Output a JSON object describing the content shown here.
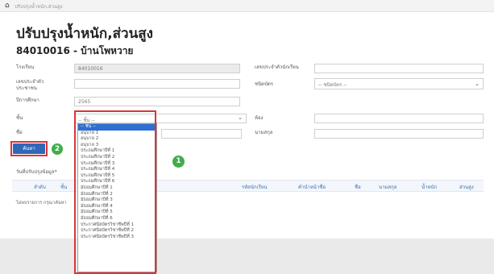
{
  "breadcrumb": {
    "text": "ปรับปรุงน้ำหนัก,ส่วนสูง"
  },
  "page": {
    "title": "ปรับปรุงน้ำหนัก,ส่วนสูง",
    "subtitle": "84010016 - บ้านโพหวาย"
  },
  "form": {
    "school_label": "โรงเรียน",
    "school_value": "84010016",
    "student_no_label": "เลขประจำตัวนักเรียน",
    "student_no_value": "",
    "citizen_id_label": "เลขประจำตัวประชาชน",
    "citizen_id_value": "",
    "prefix_label": "ชนิดบัตร",
    "prefix_value": "-- ชนิดบัตร --",
    "year_label": "ปีการศึกษา",
    "year_value": "2565",
    "class_label": "ชั้น",
    "class_value": "-- ชั้น --",
    "room_label": "ห้อง",
    "room_value": "",
    "name_label": "ชื่อ",
    "name_value": "",
    "surname_label": "นามสกุล",
    "surname_value": ""
  },
  "search_button": {
    "label": "ค้นหา",
    "badge": "2"
  },
  "dropdown_badge": "1",
  "update_date_label": "วันที่ปรับปรุงข้อมูล*",
  "table": {
    "headers": [
      "ลำดับ",
      "ชั้น",
      "รหัสนักเรียน",
      "คำนำหน้าชื่อ",
      "ชื่อ",
      "นามสกุล",
      "น้ำหนัก",
      "ส่วนสูง"
    ],
    "empty_text": "ไม่พบรายการ กรุณาค้นหา"
  },
  "dropdown_options": [
    "-- ชั้น --",
    "อนุบาล 1",
    "อนุบาล 2",
    "อนุบาล 3",
    "ประถมศึกษาปีที่ 1",
    "ประถมศึกษาปีที่ 2",
    "ประถมศึกษาปีที่ 3",
    "ประถมศึกษาปีที่ 4",
    "ประถมศึกษาปีที่ 5",
    "ประถมศึกษาปีที่ 6",
    "มัธยมศึกษาปีที่ 1",
    "มัธยมศึกษาปีที่ 2",
    "มัธยมศึกษาปีที่ 3",
    "มัธยมศึกษาปีที่ 4",
    "มัธยมศึกษาปีที่ 5",
    "มัธยมศึกษาปีที่ 6",
    "ประกาศนียบัตรวิชาชีพปีที่ 1",
    "ประกาศนียบัตรวิชาชีพปีที่ 2",
    "ประกาศนียบัตรวิชาชีพปีที่ 3"
  ],
  "icons": {
    "home": "home-icon",
    "dropdown": "chevron-down-icon"
  },
  "colors": {
    "primary": "#2f68b8",
    "highlight": "#d9353a",
    "step_badge": "#3fae4a",
    "selected_option": "#2e6fd0"
  }
}
